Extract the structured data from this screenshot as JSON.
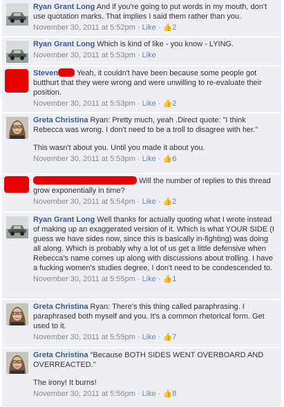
{
  "comments": [
    {
      "author": "Ryan Grant Long",
      "lines": [
        "And if you're going to put words in my mouth, don't use quotation marks. That implies I said them rather than you."
      ],
      "time": "November 30, 2011 at 5:52pm",
      "like": "Like",
      "likes": "2",
      "avatar": "car-avatar"
    },
    {
      "author": "Ryan Grant Long",
      "lines": [
        "Which is kind of like - you know - LYING."
      ],
      "time": "November 30, 2011 at 5:53pm",
      "like": "Like",
      "likes": "",
      "avatar": "car-avatar"
    },
    {
      "author": "Steven",
      "lines": [
        "Yeah, it couldn't have been because some people got butthurt that they were wrong and were unwilling to re-evaluate their position."
      ],
      "time": "November 30, 2011 at 5:53pm",
      "like": "Like",
      "likes": "2",
      "avatar": "redacted-avatar"
    },
    {
      "author": "Greta Christina",
      "lines": [
        "Ryan: Pretty much, yeah .Direct quote: \"I think Rebecca was wrong. I don't need to be a troll to disagree with her.\"",
        "This wasn't about you. Until you made it about you."
      ],
      "time": "November 30, 2011 at 5:53pm",
      "like": "Like",
      "likes": "6",
      "avatar": "person-avatar"
    },
    {
      "author": "",
      "lines": [
        "Will the number of replies to this thread grow exponentially in time?"
      ],
      "time": "November 30, 2011 at 5:54pm",
      "like": "Like",
      "likes": "2",
      "avatar": "redacted-avatar"
    },
    {
      "author": "Ryan Grant Long",
      "lines": [
        "Well thanks for actually quoting what I wrote instead of making up an exaggerated version of it. Which is what YOUR SIDE (I guess we have sides now, since this is basically in-fighting) was doing all along. Which is probably why a lot of us get a little defensive when Rebecca's name comes up along with discussions about trolling. I have a fucking women's studies degree, I don't need to be condescended to."
      ],
      "time": "November 30, 2011 at 5:55pm",
      "like": "Like",
      "likes": "1",
      "avatar": "car-avatar"
    },
    {
      "author": "Greta Christina",
      "lines": [
        "Ryan: There's this thing called paraphrasing. I paraphrased both myself and you. It's a common rhetorical form. Get used to it."
      ],
      "time": "November 30, 2011 at 5:55pm",
      "like": "Like",
      "likes": "7",
      "avatar": "person-avatar"
    },
    {
      "author": "Greta Christina",
      "lines": [
        "\"Because BOTH SIDES WENT OVERBOARD AND OVERREACTED.\"",
        "The irony! It burns!"
      ],
      "time": "November 30, 2011 at 5:56pm",
      "like": "Like",
      "likes": "8",
      "avatar": "person-avatar"
    }
  ],
  "colors": {
    "comment_bg": "#edeff4",
    "link": "#3b5998",
    "meta": "#888888",
    "redaction": "#e80000"
  }
}
